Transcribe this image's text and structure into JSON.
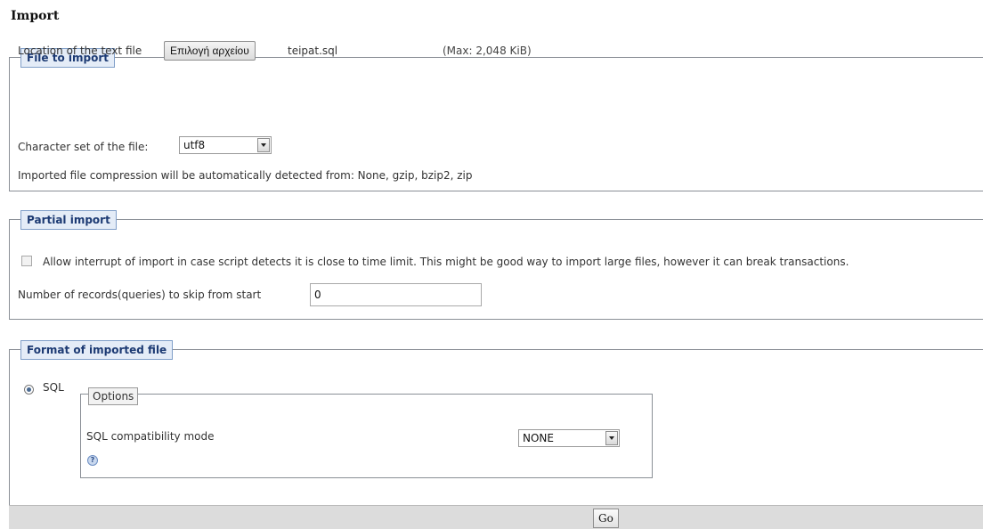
{
  "page": {
    "title": "Import"
  },
  "file_section": {
    "legend": "File to import",
    "location_label": "Location of the text file",
    "browse_button": "Επιλογή αρχείου",
    "selected_file": "teipat.sql",
    "max_size": "(Max: 2,048 KiB)",
    "charset_label": "Character set of the file:",
    "charset_value": "utf8",
    "compression_note": "Imported file compression will be automatically detected from: None, gzip, bzip2, zip"
  },
  "partial_section": {
    "legend": "Partial import",
    "interrupt_checked": false,
    "interrupt_label": "Allow interrupt of import in case script detects it is close to time limit. This might be good way to import large files, however it can break transactions.",
    "skip_label": "Number of records(queries) to skip from start",
    "skip_value": "0"
  },
  "format_section": {
    "legend": "Format of imported file",
    "format_option": "SQL",
    "options_legend": "Options",
    "compat_label": "SQL compatibility mode",
    "compat_value": "NONE",
    "help_icon": "?"
  },
  "footer": {
    "go_label": "Go"
  },
  "colors": {
    "legend_bg": "#e4ecf7",
    "legend_text": "#1c3a73",
    "footer_bg": "#dcdcdc"
  }
}
